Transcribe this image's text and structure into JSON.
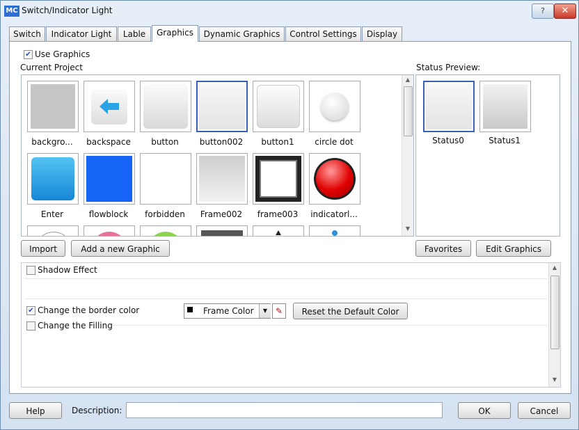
{
  "window": {
    "app_icon": "MC",
    "title": "Switch/Indicator Light",
    "help_glyph": "?",
    "close_glyph": "✕"
  },
  "tabs": [
    "Switch",
    "Indicator Light",
    "Lable",
    "Graphics",
    "Dynamic Graphics",
    "Control Settings",
    "Display"
  ],
  "active_tab": "Graphics",
  "graphics": {
    "use_graphics_label": "Use Graphics",
    "use_graphics_checked": true,
    "current_project_label": "Current Project",
    "status_preview_label": "Status Preview:",
    "items": [
      {
        "label": "backgro..."
      },
      {
        "label": "backspace"
      },
      {
        "label": "button"
      },
      {
        "label": "button002"
      },
      {
        "label": "button1"
      },
      {
        "label": "circle dot"
      },
      {
        "label": "Enter"
      },
      {
        "label": "flowblock"
      },
      {
        "label": "forbidden"
      },
      {
        "label": "Frame002"
      },
      {
        "label": "frame003"
      },
      {
        "label": "indicatorl..."
      }
    ],
    "status_items": [
      {
        "label": "Status0"
      },
      {
        "label": "Status1"
      }
    ]
  },
  "buttons": {
    "import": "Import",
    "add_new": "Add a new Graphic",
    "favorites": "Favorites",
    "edit_graphics": "Edit Graphics"
  },
  "options": {
    "shadow_effect": "Shadow Effect",
    "change_border": "Change the border color",
    "change_border_checked": true,
    "frame_color_value": "Frame Color",
    "reset_color": "Reset the Default Color",
    "change_filling": "Change the Filling"
  },
  "footer": {
    "help": "Help",
    "description_label": "Description:",
    "description_value": "",
    "ok": "OK",
    "cancel": "Cancel"
  }
}
